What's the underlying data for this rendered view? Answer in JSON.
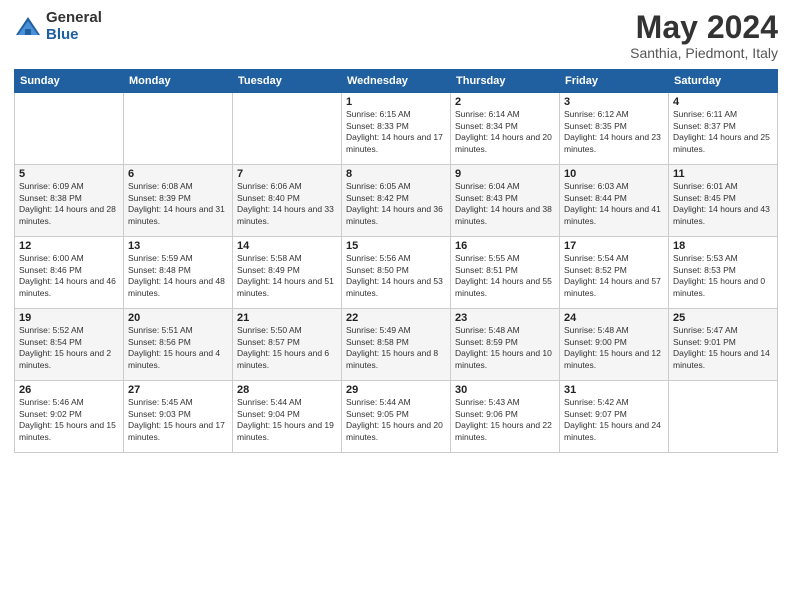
{
  "logo": {
    "general": "General",
    "blue": "Blue"
  },
  "title": "May 2024",
  "subtitle": "Santhia, Piedmont, Italy",
  "days_header": [
    "Sunday",
    "Monday",
    "Tuesday",
    "Wednesday",
    "Thursday",
    "Friday",
    "Saturday"
  ],
  "weeks": [
    [
      {
        "day": "",
        "sunrise": "",
        "sunset": "",
        "daylight": ""
      },
      {
        "day": "",
        "sunrise": "",
        "sunset": "",
        "daylight": ""
      },
      {
        "day": "",
        "sunrise": "",
        "sunset": "",
        "daylight": ""
      },
      {
        "day": "1",
        "sunrise": "Sunrise: 6:15 AM",
        "sunset": "Sunset: 8:33 PM",
        "daylight": "Daylight: 14 hours and 17 minutes."
      },
      {
        "day": "2",
        "sunrise": "Sunrise: 6:14 AM",
        "sunset": "Sunset: 8:34 PM",
        "daylight": "Daylight: 14 hours and 20 minutes."
      },
      {
        "day": "3",
        "sunrise": "Sunrise: 6:12 AM",
        "sunset": "Sunset: 8:35 PM",
        "daylight": "Daylight: 14 hours and 23 minutes."
      },
      {
        "day": "4",
        "sunrise": "Sunrise: 6:11 AM",
        "sunset": "Sunset: 8:37 PM",
        "daylight": "Daylight: 14 hours and 25 minutes."
      }
    ],
    [
      {
        "day": "5",
        "sunrise": "Sunrise: 6:09 AM",
        "sunset": "Sunset: 8:38 PM",
        "daylight": "Daylight: 14 hours and 28 minutes."
      },
      {
        "day": "6",
        "sunrise": "Sunrise: 6:08 AM",
        "sunset": "Sunset: 8:39 PM",
        "daylight": "Daylight: 14 hours and 31 minutes."
      },
      {
        "day": "7",
        "sunrise": "Sunrise: 6:06 AM",
        "sunset": "Sunset: 8:40 PM",
        "daylight": "Daylight: 14 hours and 33 minutes."
      },
      {
        "day": "8",
        "sunrise": "Sunrise: 6:05 AM",
        "sunset": "Sunset: 8:42 PM",
        "daylight": "Daylight: 14 hours and 36 minutes."
      },
      {
        "day": "9",
        "sunrise": "Sunrise: 6:04 AM",
        "sunset": "Sunset: 8:43 PM",
        "daylight": "Daylight: 14 hours and 38 minutes."
      },
      {
        "day": "10",
        "sunrise": "Sunrise: 6:03 AM",
        "sunset": "Sunset: 8:44 PM",
        "daylight": "Daylight: 14 hours and 41 minutes."
      },
      {
        "day": "11",
        "sunrise": "Sunrise: 6:01 AM",
        "sunset": "Sunset: 8:45 PM",
        "daylight": "Daylight: 14 hours and 43 minutes."
      }
    ],
    [
      {
        "day": "12",
        "sunrise": "Sunrise: 6:00 AM",
        "sunset": "Sunset: 8:46 PM",
        "daylight": "Daylight: 14 hours and 46 minutes."
      },
      {
        "day": "13",
        "sunrise": "Sunrise: 5:59 AM",
        "sunset": "Sunset: 8:48 PM",
        "daylight": "Daylight: 14 hours and 48 minutes."
      },
      {
        "day": "14",
        "sunrise": "Sunrise: 5:58 AM",
        "sunset": "Sunset: 8:49 PM",
        "daylight": "Daylight: 14 hours and 51 minutes."
      },
      {
        "day": "15",
        "sunrise": "Sunrise: 5:56 AM",
        "sunset": "Sunset: 8:50 PM",
        "daylight": "Daylight: 14 hours and 53 minutes."
      },
      {
        "day": "16",
        "sunrise": "Sunrise: 5:55 AM",
        "sunset": "Sunset: 8:51 PM",
        "daylight": "Daylight: 14 hours and 55 minutes."
      },
      {
        "day": "17",
        "sunrise": "Sunrise: 5:54 AM",
        "sunset": "Sunset: 8:52 PM",
        "daylight": "Daylight: 14 hours and 57 minutes."
      },
      {
        "day": "18",
        "sunrise": "Sunrise: 5:53 AM",
        "sunset": "Sunset: 8:53 PM",
        "daylight": "Daylight: 15 hours and 0 minutes."
      }
    ],
    [
      {
        "day": "19",
        "sunrise": "Sunrise: 5:52 AM",
        "sunset": "Sunset: 8:54 PM",
        "daylight": "Daylight: 15 hours and 2 minutes."
      },
      {
        "day": "20",
        "sunrise": "Sunrise: 5:51 AM",
        "sunset": "Sunset: 8:56 PM",
        "daylight": "Daylight: 15 hours and 4 minutes."
      },
      {
        "day": "21",
        "sunrise": "Sunrise: 5:50 AM",
        "sunset": "Sunset: 8:57 PM",
        "daylight": "Daylight: 15 hours and 6 minutes."
      },
      {
        "day": "22",
        "sunrise": "Sunrise: 5:49 AM",
        "sunset": "Sunset: 8:58 PM",
        "daylight": "Daylight: 15 hours and 8 minutes."
      },
      {
        "day": "23",
        "sunrise": "Sunrise: 5:48 AM",
        "sunset": "Sunset: 8:59 PM",
        "daylight": "Daylight: 15 hours and 10 minutes."
      },
      {
        "day": "24",
        "sunrise": "Sunrise: 5:48 AM",
        "sunset": "Sunset: 9:00 PM",
        "daylight": "Daylight: 15 hours and 12 minutes."
      },
      {
        "day": "25",
        "sunrise": "Sunrise: 5:47 AM",
        "sunset": "Sunset: 9:01 PM",
        "daylight": "Daylight: 15 hours and 14 minutes."
      }
    ],
    [
      {
        "day": "26",
        "sunrise": "Sunrise: 5:46 AM",
        "sunset": "Sunset: 9:02 PM",
        "daylight": "Daylight: 15 hours and 15 minutes."
      },
      {
        "day": "27",
        "sunrise": "Sunrise: 5:45 AM",
        "sunset": "Sunset: 9:03 PM",
        "daylight": "Daylight: 15 hours and 17 minutes."
      },
      {
        "day": "28",
        "sunrise": "Sunrise: 5:44 AM",
        "sunset": "Sunset: 9:04 PM",
        "daylight": "Daylight: 15 hours and 19 minutes."
      },
      {
        "day": "29",
        "sunrise": "Sunrise: 5:44 AM",
        "sunset": "Sunset: 9:05 PM",
        "daylight": "Daylight: 15 hours and 20 minutes."
      },
      {
        "day": "30",
        "sunrise": "Sunrise: 5:43 AM",
        "sunset": "Sunset: 9:06 PM",
        "daylight": "Daylight: 15 hours and 22 minutes."
      },
      {
        "day": "31",
        "sunrise": "Sunrise: 5:42 AM",
        "sunset": "Sunset: 9:07 PM",
        "daylight": "Daylight: 15 hours and 24 minutes."
      },
      {
        "day": "",
        "sunrise": "",
        "sunset": "",
        "daylight": ""
      }
    ]
  ]
}
